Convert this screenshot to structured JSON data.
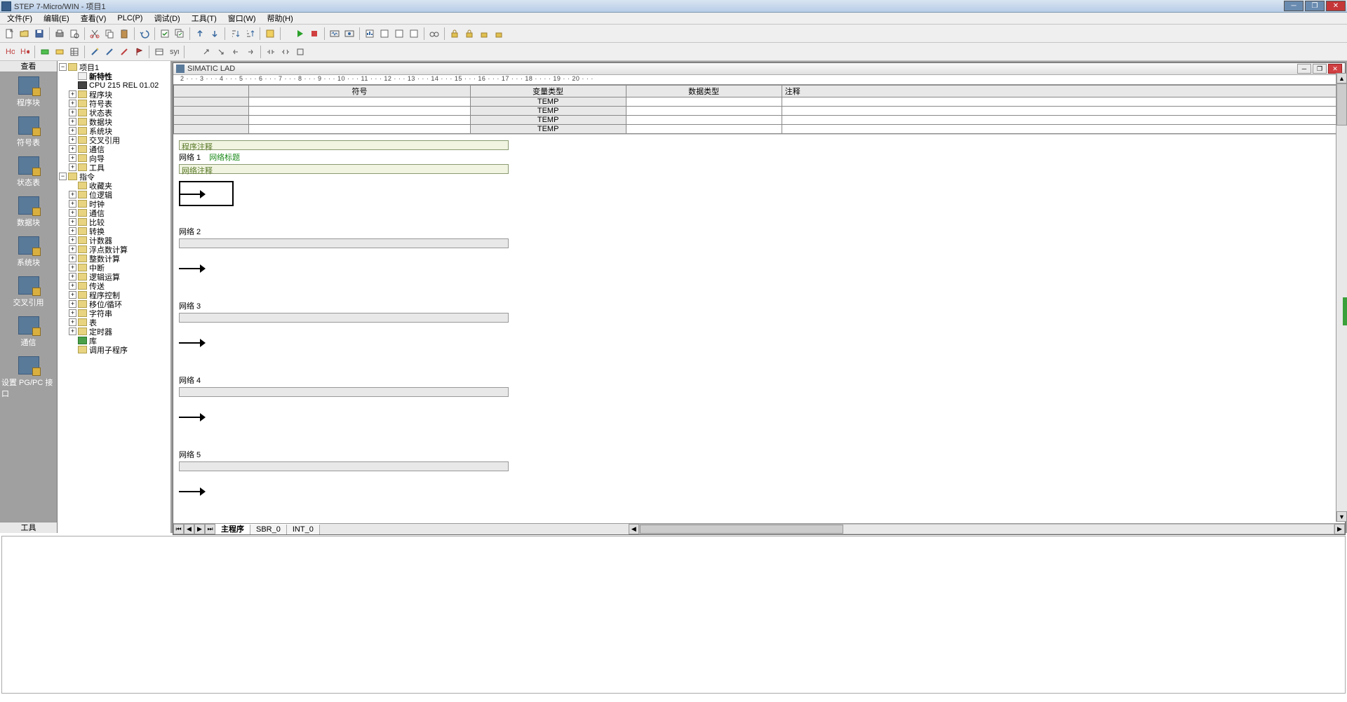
{
  "app": {
    "title": "STEP 7-Micro/WIN - 项目1"
  },
  "menu": {
    "file": "文件(F)",
    "edit": "编辑(E)",
    "view": "查看(V)",
    "plc": "PLC(P)",
    "debug": "调试(D)",
    "tools": "工具(T)",
    "window": "窗口(W)",
    "help": "帮助(H)"
  },
  "nav": {
    "header": "查看",
    "items": [
      {
        "label": "程序块"
      },
      {
        "label": "符号表"
      },
      {
        "label": "状态表"
      },
      {
        "label": "数据块"
      },
      {
        "label": "系统块"
      },
      {
        "label": "交叉引用"
      },
      {
        "label": "通信"
      },
      {
        "label": "设置 PG/PC 接口"
      }
    ],
    "footer": "工具"
  },
  "tree": {
    "root": "项目1",
    "new_feature": "新特性",
    "cpu": "CPU 215 REL 01.02",
    "groups1": [
      "程序块",
      "符号表",
      "状态表",
      "数据块",
      "系统块",
      "交叉引用",
      "通信",
      "向导",
      "工具"
    ],
    "instr": "指令",
    "fav": "收藏夹",
    "groups2": [
      "位逻辑",
      "时钟",
      "通信",
      "比较",
      "转换",
      "计数器",
      "浮点数计算",
      "整数计算",
      "中断",
      "逻辑运算",
      "传送",
      "程序控制",
      "移位/循环",
      "字符串",
      "表",
      "定时器",
      "库",
      "调用子程序"
    ]
  },
  "mdi": {
    "title": "SIMATIC LAD"
  },
  "ruler": "2 · · · 3 · · · 4 · · · 5 · · · 6 · · · 7 · · · 8 · · · 9 · · · 10 · · · 11 · · · 12 · · · 13 · · · 14 · · · 15 · · · 16 · · · 17 · · · 18 · · ·      · 19 · · 20 · · ·",
  "var_table": {
    "headers": {
      "symbol": "符号",
      "vartype": "变量类型",
      "datatype": "数据类型",
      "comment": "注释"
    },
    "rows": [
      {
        "vartype": "TEMP"
      },
      {
        "vartype": "TEMP"
      },
      {
        "vartype": "TEMP"
      },
      {
        "vartype": "TEMP"
      }
    ]
  },
  "lad": {
    "prog_comment": "程序注释",
    "net_title_link": "网络标题",
    "net_comment": "网络注释",
    "networks": [
      {
        "label": "网络 1",
        "has_box": true,
        "show_title_link": true,
        "green_sub": true
      },
      {
        "label": "网络 2"
      },
      {
        "label": "网络 3"
      },
      {
        "label": "网络 4"
      },
      {
        "label": "网络 5"
      }
    ]
  },
  "tabs": {
    "main": "主程序",
    "sbr": "SBR_0",
    "int": "INT_0"
  }
}
